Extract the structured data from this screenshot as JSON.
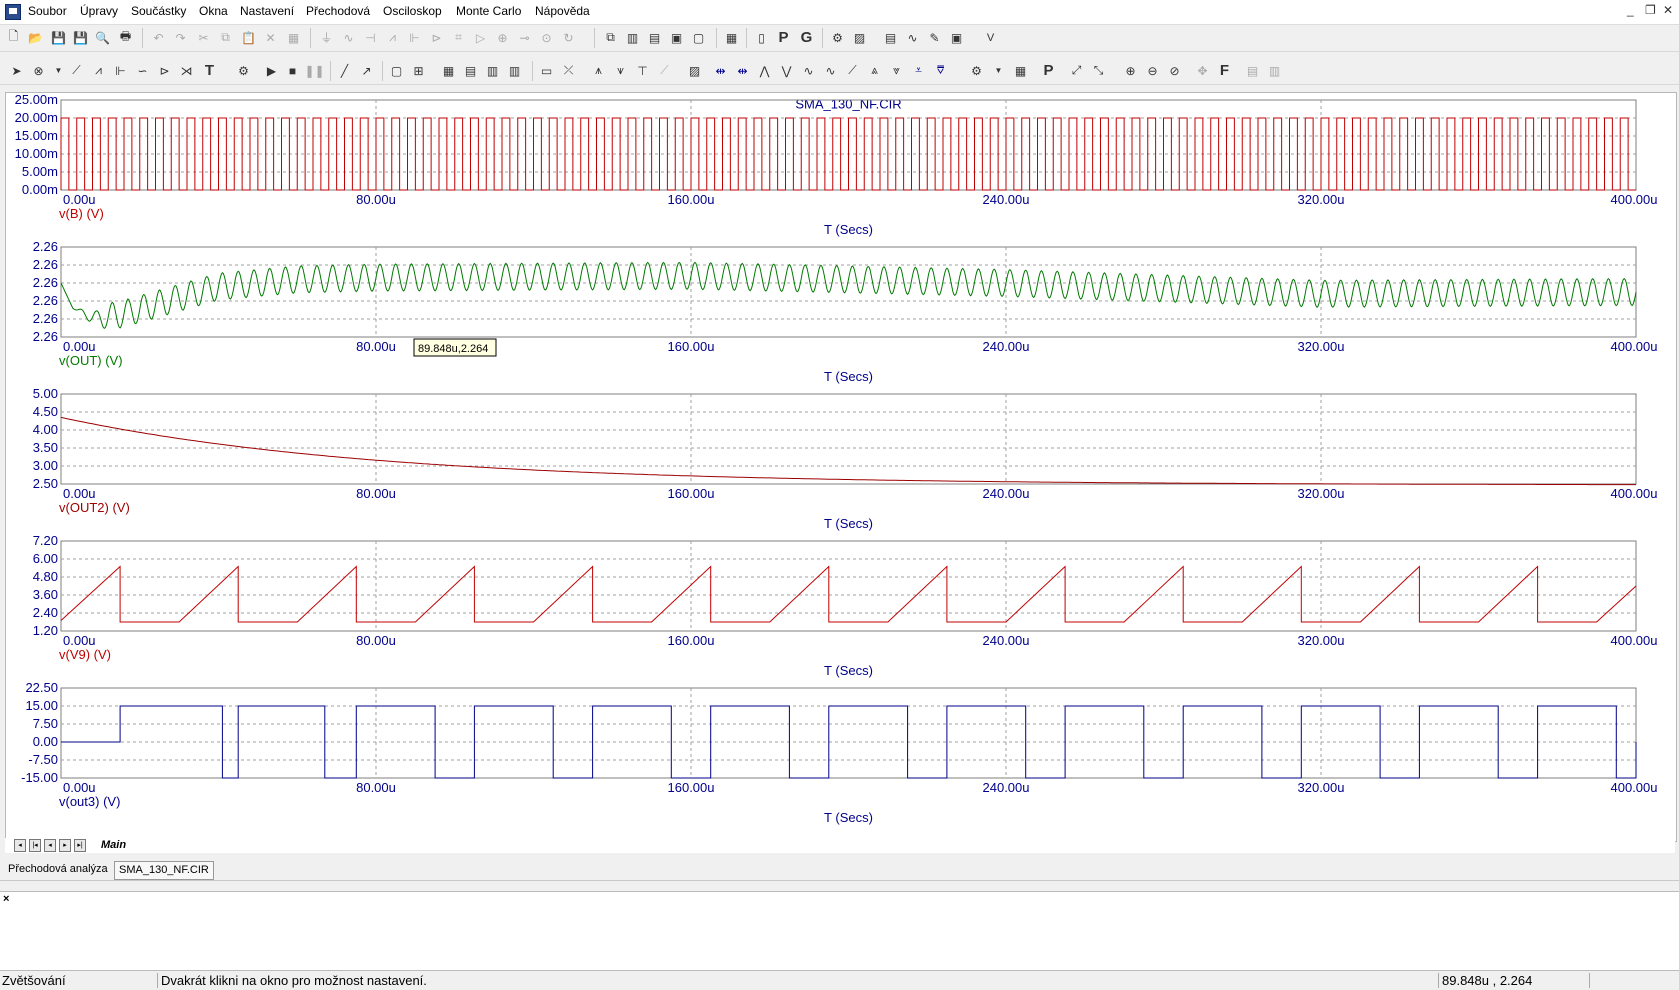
{
  "menu": {
    "items": [
      "Soubor",
      "Úpravy",
      "Součástky",
      "Okna",
      "Nastavení",
      "Přechodová",
      "Osciloskop",
      "Monte Carlo",
      "Nápověda"
    ]
  },
  "toolbar": {
    "text_buttons": [
      "P",
      "G",
      "T",
      "P",
      "F"
    ]
  },
  "chart_title": "SMA_130_NF.CIR",
  "cursor_tooltip": "89.848u,2.264",
  "chart_data": [
    {
      "type": "line",
      "xlabel": "T (Secs)",
      "xtick_labels": [
        "0.00u",
        "80.00u",
        "160.00u",
        "240.00u",
        "320.00u",
        "400.00u"
      ],
      "xlim": [
        0,
        400
      ],
      "x_unit": "u",
      "ylabel": "v(B) (V)",
      "ytick_labels": [
        "25.00m",
        "20.00m",
        "15.00m",
        "10.00m",
        "5.00m",
        "0.00m"
      ],
      "ylim": [
        0,
        25
      ],
      "grid": true,
      "color": "#c00000",
      "series": [
        {
          "name": "v(B) (V)",
          "shape": "square",
          "period": 4,
          "duty": 0.5,
          "low": 0,
          "high": 20
        }
      ]
    },
    {
      "type": "line",
      "xlabel": "T (Secs)",
      "xtick_labels": [
        "0.00u",
        "80.00u",
        "160.00u",
        "240.00u",
        "320.00u",
        "400.00u"
      ],
      "xlim": [
        0,
        400
      ],
      "ylabel": "v(OUT) (V)",
      "ytick_labels": [
        "2.26",
        "2.26",
        "2.26",
        "2.26",
        "2.26",
        "2.26"
      ],
      "ylim": [
        0,
        5
      ],
      "grid": true,
      "color": "#007a00",
      "series": [
        {
          "name": "v(OUT) (V)",
          "shape": "ripple",
          "period": 4,
          "points": [
            [
              0,
              3.0
            ],
            [
              3,
              1.6
            ],
            [
              9,
              1.0
            ],
            [
              16,
              1.3
            ],
            [
              40,
              2.8
            ],
            [
              60,
              3.2
            ],
            [
              80,
              3.3
            ],
            [
              160,
              3.4
            ],
            [
              240,
              3.0
            ],
            [
              320,
              2.4
            ],
            [
              400,
              2.5
            ]
          ],
          "ripple_amplitude": 0.75
        }
      ]
    },
    {
      "type": "line",
      "xlabel": "T (Secs)",
      "xtick_labels": [
        "0.00u",
        "80.00u",
        "160.00u",
        "240.00u",
        "320.00u",
        "400.00u"
      ],
      "xlim": [
        0,
        400
      ],
      "ylabel": "v(OUT2) (V)",
      "ytick_labels": [
        "5.00",
        "4.50",
        "4.00",
        "3.50",
        "3.00",
        "2.50"
      ],
      "ylim": [
        2.5,
        5.0
      ],
      "grid": true,
      "color": "#9c0000",
      "series": [
        {
          "name": "v(OUT2) (V)",
          "shape": "decay",
          "start": 4.35,
          "final": 2.47,
          "tau": 80
        }
      ]
    },
    {
      "type": "line",
      "xlabel": "T (Secs)",
      "xtick_labels": [
        "0.00u",
        "80.00u",
        "160.00u",
        "240.00u",
        "320.00u",
        "400.00u"
      ],
      "xlim": [
        0,
        400
      ],
      "ylabel": "v(V9) (V)",
      "ytick_labels": [
        "7.20",
        "6.00",
        "4.80",
        "3.60",
        "2.40",
        "1.20"
      ],
      "ylim": [
        1.2,
        7.2
      ],
      "grid": true,
      "color": "#c00000",
      "series": [
        {
          "name": "v(V9) (V)",
          "shape": "sawtooth",
          "points": [
            [
              0,
              1.9
            ],
            [
              15,
              5.5
            ],
            [
              15,
              1.8
            ],
            [
              30,
              1.8
            ],
            [
              45,
              5.5
            ],
            [
              45,
              1.8
            ],
            [
              60,
              1.8
            ],
            [
              75,
              5.5
            ],
            [
              75,
              1.8
            ],
            [
              90,
              1.8
            ],
            [
              105,
              5.5
            ],
            [
              105,
              1.8
            ],
            [
              120,
              1.8
            ],
            [
              135,
              5.5
            ],
            [
              135,
              1.8
            ],
            [
              150,
              1.8
            ],
            [
              165,
              5.5
            ],
            [
              165,
              1.8
            ],
            [
              180,
              1.8
            ],
            [
              195,
              5.5
            ],
            [
              195,
              1.8
            ],
            [
              210,
              1.8
            ],
            [
              225,
              5.5
            ],
            [
              225,
              1.8
            ],
            [
              240,
              1.8
            ],
            [
              255,
              5.5
            ],
            [
              255,
              1.8
            ],
            [
              270,
              1.8
            ],
            [
              285,
              5.5
            ],
            [
              285,
              1.8
            ],
            [
              300,
              1.8
            ],
            [
              315,
              5.5
            ],
            [
              315,
              1.8
            ],
            [
              330,
              1.8
            ],
            [
              345,
              5.5
            ],
            [
              345,
              1.8
            ],
            [
              360,
              1.8
            ],
            [
              375,
              5.5
            ],
            [
              375,
              1.8
            ],
            [
              390,
              1.8
            ],
            [
              400,
              4.2
            ]
          ]
        }
      ]
    },
    {
      "type": "line",
      "xlabel": "T (Secs)",
      "xtick_labels": [
        "0.00u",
        "80.00u",
        "160.00u",
        "240.00u",
        "320.00u",
        "400.00u"
      ],
      "xlim": [
        0,
        400
      ],
      "ylabel": "v(out3) (V)",
      "ytick_labels": [
        "22.50",
        "15.00",
        "7.50",
        "0.00",
        "-7.50",
        "-15.00"
      ],
      "ylim": [
        -15,
        22.5
      ],
      "grid": true,
      "color": "#00008b",
      "series": [
        {
          "name": "v(out3) (V)",
          "shape": "pulses",
          "baseline": 0,
          "pulses": [
            [
              15,
              41,
              15
            ],
            [
              41,
              45,
              -15
            ],
            [
              45,
              67,
              15
            ],
            [
              67,
              75,
              -15
            ],
            [
              75,
              95,
              15
            ],
            [
              95,
              105,
              -15
            ],
            [
              105,
              125,
              15
            ],
            [
              125,
              135,
              -15
            ],
            [
              135,
              155,
              15
            ],
            [
              155,
              165,
              -15
            ],
            [
              165,
              185,
              15
            ],
            [
              185,
              195,
              -15
            ],
            [
              195,
              215,
              15
            ],
            [
              215,
              225,
              -15
            ],
            [
              225,
              245,
              15
            ],
            [
              245,
              255,
              -15
            ],
            [
              255,
              275,
              15
            ],
            [
              275,
              285,
              -15
            ],
            [
              285,
              305,
              15
            ],
            [
              305,
              315,
              -15
            ],
            [
              315,
              335,
              15
            ],
            [
              335,
              345,
              -15
            ],
            [
              345,
              365,
              15
            ],
            [
              365,
              375,
              -15
            ],
            [
              375,
              395,
              15
            ],
            [
              395,
              400,
              -15
            ]
          ]
        }
      ]
    }
  ],
  "plot_tabs": {
    "main": "Main"
  },
  "doc_tabs": [
    "Přechodová analýza",
    "SMA_130_NF.CIR"
  ],
  "status": {
    "mode": "Zvětšování",
    "hint": "Dvakrát klikni na okno pro možnost nastavení.",
    "coords": "89.848u , 2.264"
  },
  "colors": {
    "axis_text": "#00008b",
    "grid": "#a0a0a0",
    "frame": "#7f7f7f"
  }
}
